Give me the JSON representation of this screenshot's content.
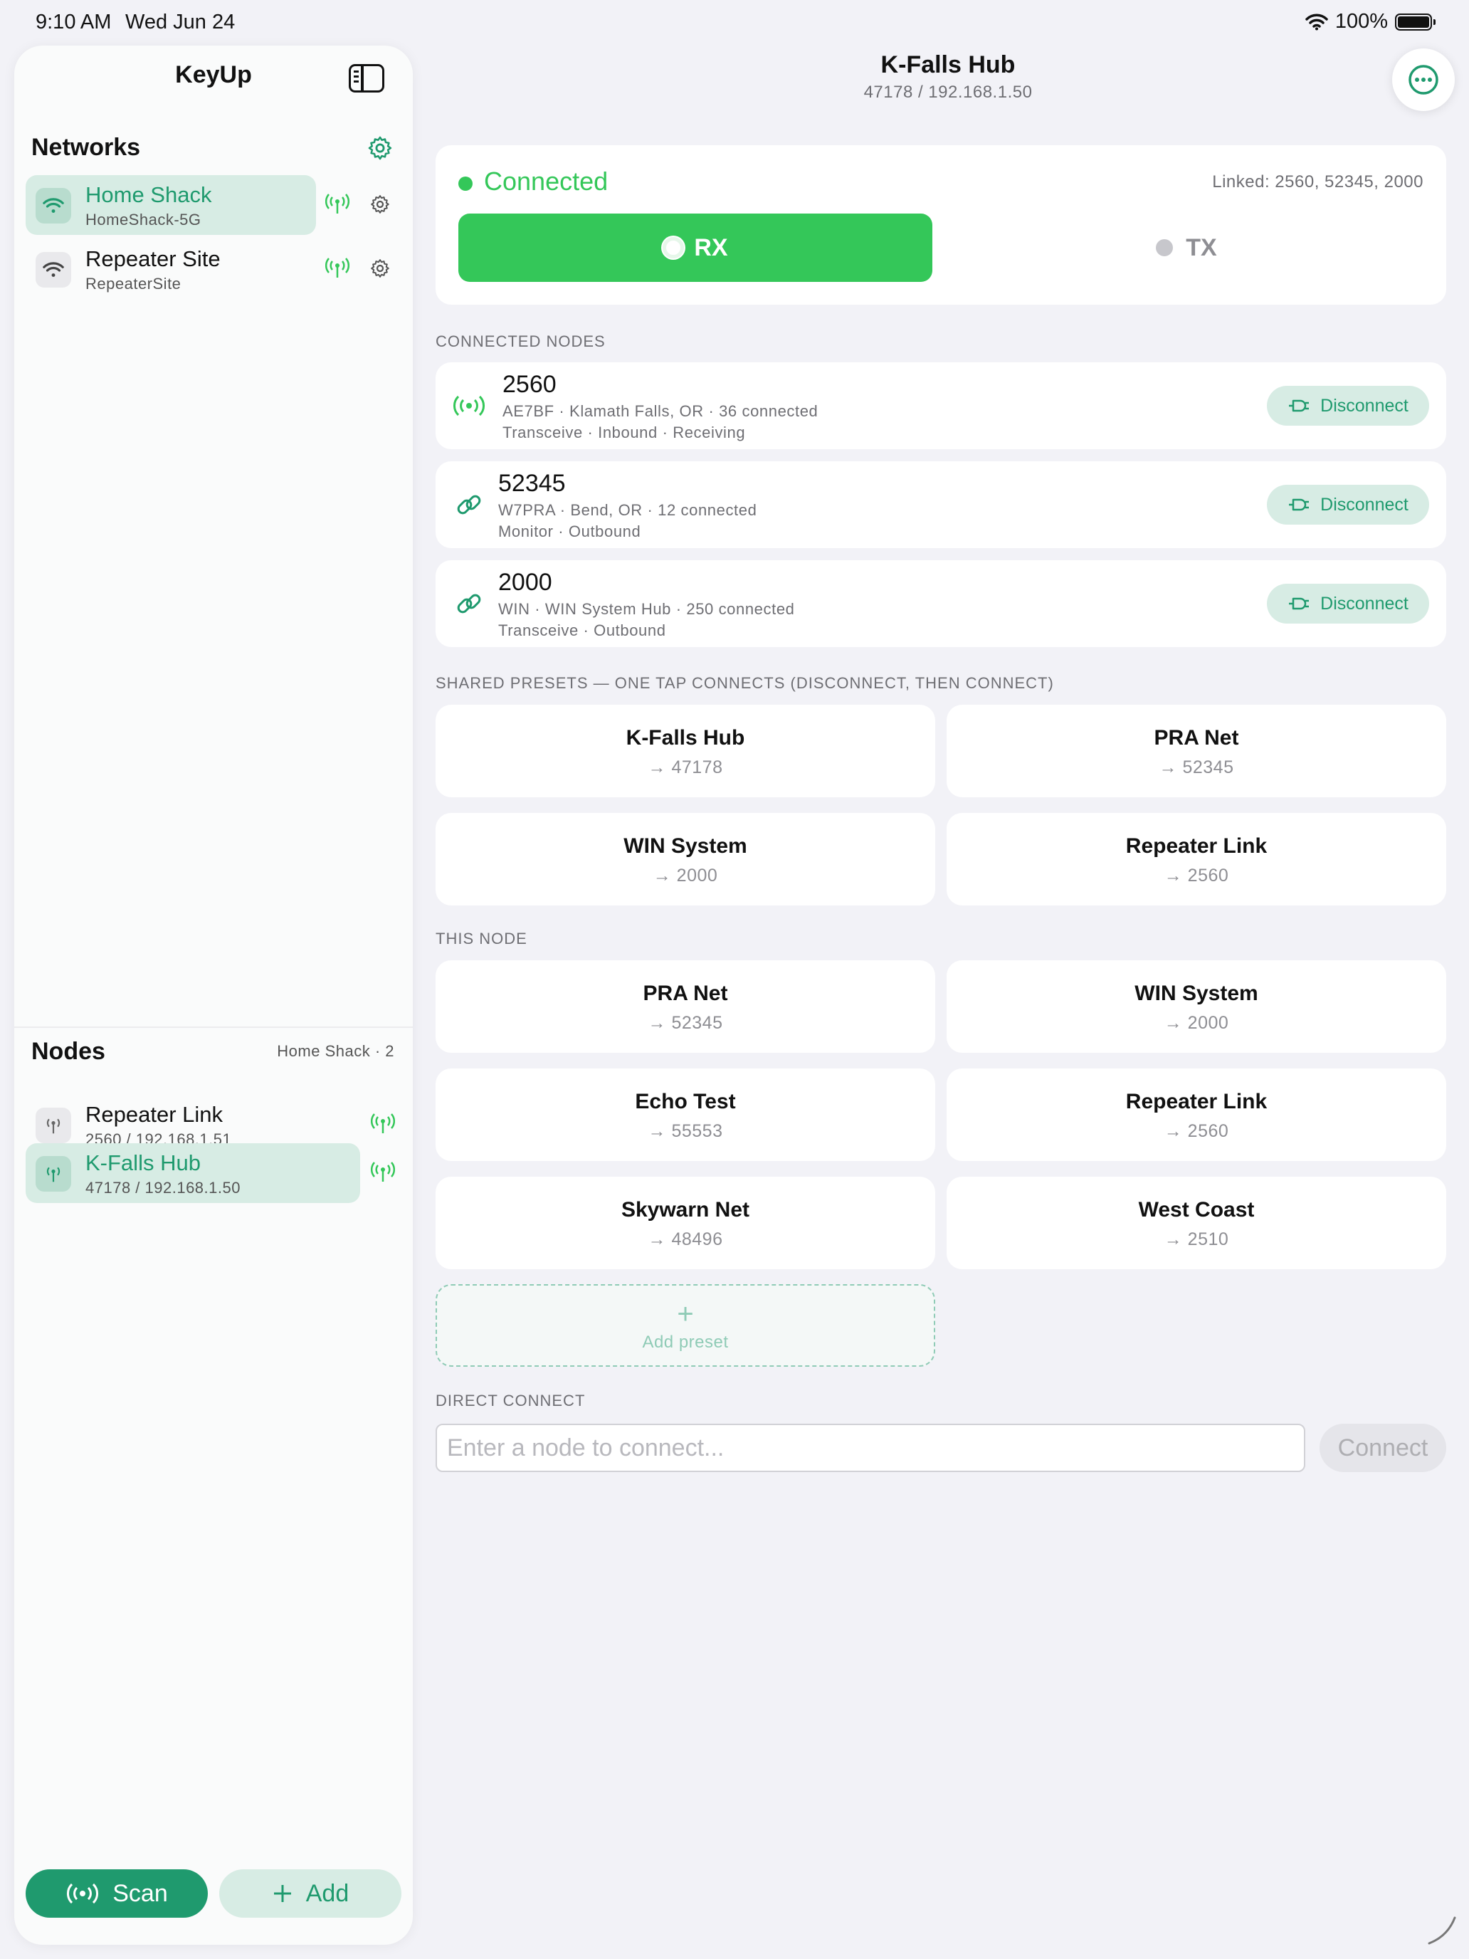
{
  "status_bar": {
    "time": "9:10 AM",
    "date": "Wed Jun 24",
    "battery": "100%"
  },
  "sidebar": {
    "title": "KeyUp",
    "networks_heading": "Networks",
    "networks": [
      {
        "name": "Home Shack",
        "ssid": "HomeShack-5G",
        "active": true
      },
      {
        "name": "Repeater Site",
        "ssid": "RepeaterSite",
        "active": false
      }
    ],
    "nodes_heading": "Nodes",
    "nodes_meta": "Home Shack · 2",
    "nodes": [
      {
        "name": "Repeater Link",
        "detail": "2560 / 192.168.1.51",
        "active": false
      },
      {
        "name": "K-Falls Hub",
        "detail": "47178 / 192.168.1.50",
        "active": true
      }
    ],
    "scan_label": "Scan",
    "add_label": "Add"
  },
  "header": {
    "title": "K-Falls Hub",
    "subtitle": "47178 / 192.168.1.50"
  },
  "status": {
    "label": "Connected",
    "linked": "Linked: 2560, 52345, 2000",
    "rx_label": "RX",
    "tx_label": "TX"
  },
  "connected_nodes": {
    "caption": "CONNECTED NODES",
    "disconnect_label": "Disconnect",
    "items": [
      {
        "number": "2560",
        "line1": "AE7BF · Klamath Falls, OR · 36 connected",
        "line2": "Transceive · Inbound · Receiving",
        "icon": "broadcast-icon"
      },
      {
        "number": "52345",
        "line1": "W7PRA · Bend, OR · 12 connected",
        "line2": "Monitor · Outbound",
        "icon": "link-icon"
      },
      {
        "number": "2000",
        "line1": "WIN · WIN System Hub · 250 connected",
        "line2": "Transceive · Outbound",
        "icon": "link-icon"
      }
    ]
  },
  "shared_presets": {
    "caption": "SHARED PRESETS — ONE TAP CONNECTS (DISCONNECT, THEN CONNECT)",
    "items": [
      {
        "name": "K-Falls Hub",
        "target": "→ 47178"
      },
      {
        "name": "PRA Net",
        "target": "→ 52345"
      },
      {
        "name": "WIN System",
        "target": "→ 2000"
      },
      {
        "name": "Repeater Link",
        "target": "→ 2560"
      }
    ]
  },
  "this_node": {
    "caption": "THIS NODE",
    "items": [
      {
        "name": "PRA Net",
        "target": "→ 52345"
      },
      {
        "name": "WIN System",
        "target": "→ 2000"
      },
      {
        "name": "Echo Test",
        "target": "→ 55553"
      },
      {
        "name": "Repeater Link",
        "target": "→ 2560"
      },
      {
        "name": "Skywarn Net",
        "target": "→ 48496"
      },
      {
        "name": "West Coast",
        "target": "→ 2510"
      }
    ],
    "add_preset_label": "Add preset"
  },
  "direct_connect": {
    "caption": "DIRECT CONNECT",
    "placeholder": "Enter a node to connect...",
    "value": "",
    "button_label": "Connect"
  },
  "colors": {
    "accent": "#1f9a6e",
    "connected": "#34c759",
    "accent_light": "#d7ece4"
  }
}
